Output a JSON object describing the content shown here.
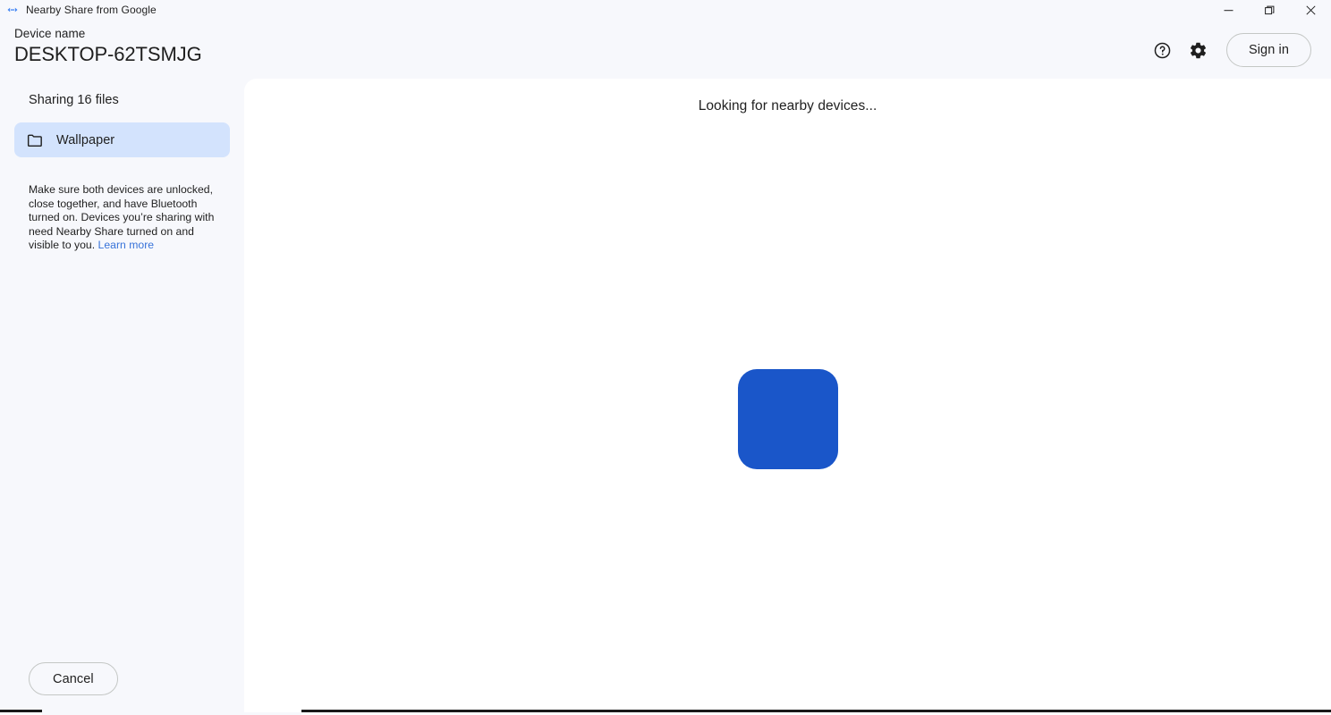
{
  "window": {
    "title": "Nearby Share from Google",
    "app_icon": "nearby-share-icon",
    "controls": {
      "minimize": "minimize-icon",
      "maximize": "restore-icon",
      "close": "close-icon"
    }
  },
  "header": {
    "device_label": "Device name",
    "device_name": "DESKTOP-62TSMJG",
    "help_icon": "help-circle-icon",
    "settings_icon": "gear-icon",
    "sign_in_label": "Sign in"
  },
  "sidebar": {
    "sharing_count": "Sharing 16 files",
    "files": [
      {
        "name": "Wallpaper",
        "icon": "folder-icon"
      }
    ],
    "hint_text": "Make sure both devices are unlocked, close together, and have Bluetooth turned on. Devices you’re sharing with need Nearby Share turned on and visible to you. ",
    "learn_more_label": "Learn more",
    "cancel_label": "Cancel"
  },
  "main": {
    "status_title": "Looking for nearby devices...",
    "device_blob_color": "#1a56c9"
  },
  "colors": {
    "accent": "#1a56c9",
    "chip_background": "#d3e3fd",
    "link": "#3873d9",
    "surface": "#f7f8fc",
    "panel": "#ffffff"
  }
}
